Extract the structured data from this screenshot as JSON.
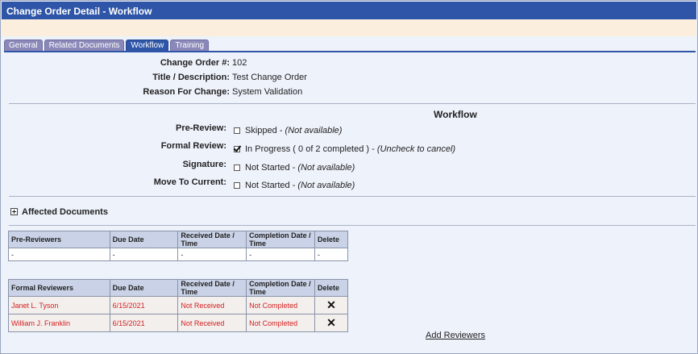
{
  "window": {
    "title": "Change Order Detail - Workflow"
  },
  "tabs": [
    {
      "label": "General",
      "active": false
    },
    {
      "label": "Related Documents",
      "active": false
    },
    {
      "label": "Workflow",
      "active": true
    },
    {
      "label": "Training",
      "active": false
    }
  ],
  "details": {
    "change_order_label": "Change Order #:",
    "change_order_value": "102",
    "title_label": "Title / Description:",
    "title_value": "Test Change Order",
    "reason_label": "Reason For Change:",
    "reason_value": "System Validation"
  },
  "workflow": {
    "heading": "Workflow",
    "steps": [
      {
        "label": "Pre-Review:",
        "status": "Skipped",
        "note": "(Not available)",
        "checked": false
      },
      {
        "label": "Formal Review:",
        "status": "In Progress ( 0 of 2 completed )",
        "note": "(Uncheck to cancel)",
        "checked": true
      },
      {
        "label": "Signature:",
        "status": "Not Started",
        "note": "(Not available)",
        "checked": false
      },
      {
        "label": "Move To Current:",
        "status": "Not Started",
        "note": "(Not available)",
        "checked": false
      }
    ],
    "separator": " - "
  },
  "affected_documents": {
    "label": "Affected Documents"
  },
  "pre_reviewers_table": {
    "headers": [
      "Pre-Reviewers",
      "Due Date",
      "Received Date / Time",
      "Completion Date / Time",
      "Delete"
    ],
    "rows": [
      [
        "-",
        "-",
        "-",
        "-",
        "-"
      ]
    ]
  },
  "formal_reviewers_table": {
    "headers": [
      "Formal Reviewers",
      "Due Date",
      "Received Date / Time",
      "Completion Date / Time",
      "Delete"
    ],
    "rows": [
      [
        "Janet L. Tyson",
        "6/15/2021",
        "Not Received",
        "Not Completed",
        "✕"
      ],
      [
        "William J. Franklin",
        "6/15/2021",
        "Not Received",
        "Not Completed",
        "✕"
      ]
    ]
  },
  "actions": {
    "add_reviewers": "Add Reviewers"
  },
  "colors": {
    "titlebar": "#2e55a7",
    "banner": "#fbeedd",
    "reviewer_text": "#d21f1f"
  }
}
